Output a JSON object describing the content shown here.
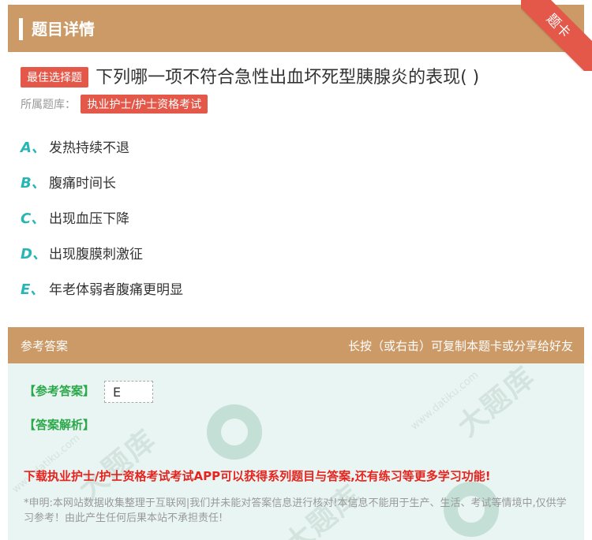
{
  "header": {
    "title": "题目详情"
  },
  "ribbon": {
    "label": "题卡"
  },
  "question": {
    "badge": "最佳选择题",
    "text": "下列哪一项不符合急性出血坏死型胰腺炎的表现( )",
    "library_label": "所属题库：",
    "library_tag": "执业护士/护士资格考试"
  },
  "options": [
    {
      "letter": "A、",
      "text": "发热持续不退"
    },
    {
      "letter": "B、",
      "text": "腹痛时间长"
    },
    {
      "letter": "C、",
      "text": "出现血压下降"
    },
    {
      "letter": "D、",
      "text": "出现腹膜刺激征"
    },
    {
      "letter": "E、",
      "text": "年老体弱者腹痛更明显"
    }
  ],
  "answer_bar": {
    "left": "参考答案",
    "right": "长按（或右击）可复制本题卡或分享给好友"
  },
  "answer": {
    "label": "【参考答案】",
    "value": "E",
    "analysis_label": "【答案解析】"
  },
  "promo": "下载执业护士/护士资格考试考试APP可以获得系列题目与答案,还有练习等更多学习功能!",
  "disclaimer": "*申明:本网站数据收集整理于互联网|我们并未能对答案信息进行核对!本信息不能用于生产、生活、考试等情境中,仅供学习参考！由此产生任何后果本站不承担责任!",
  "watermark": {
    "text": "大题库",
    "url": "www.datiku.com"
  },
  "colors": {
    "header": "#cc9a67",
    "accent_red": "#e4584a",
    "option_letter": "#28b5b5",
    "answer_green": "#2aa84a",
    "answer_bg": "#e9f5f2"
  }
}
